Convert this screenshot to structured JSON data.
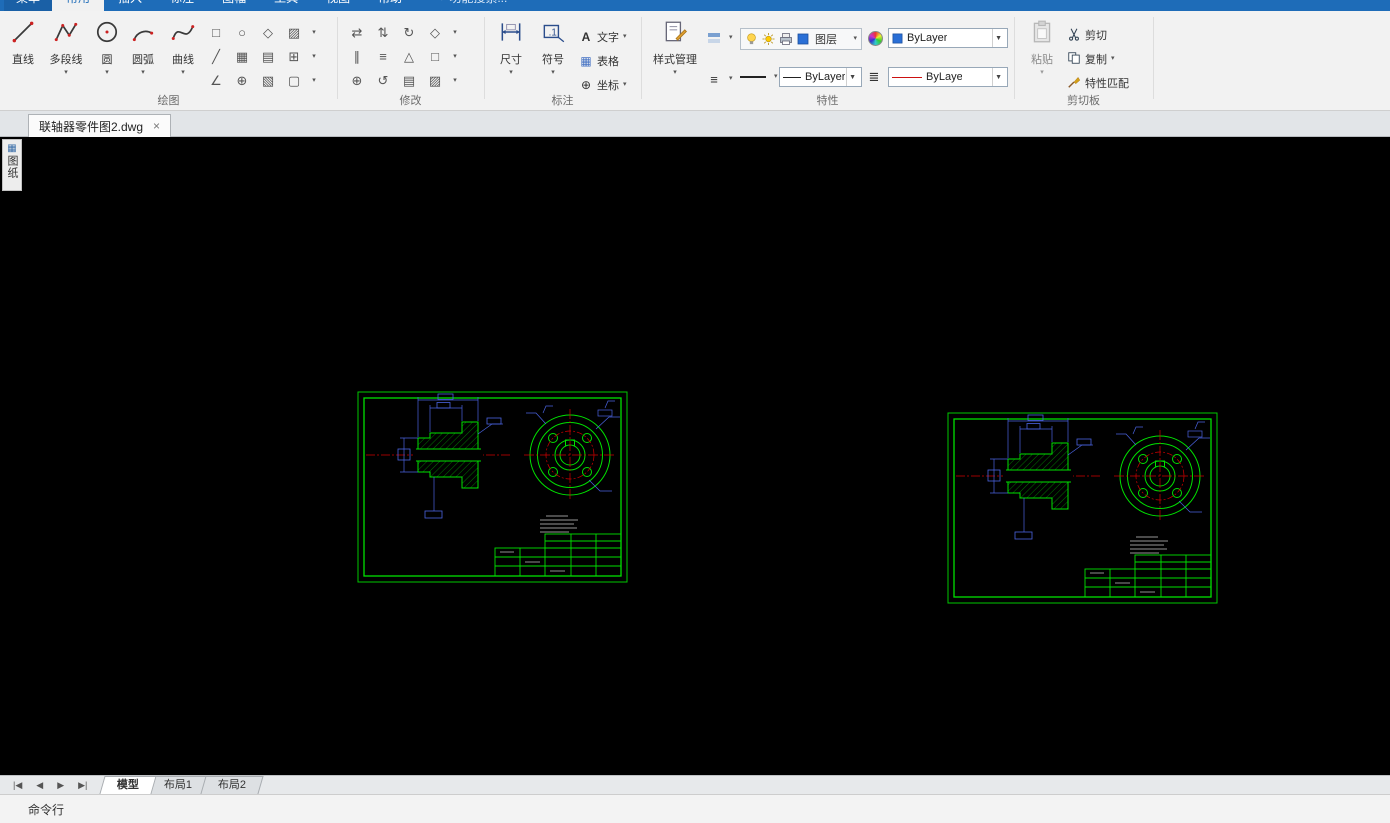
{
  "ui_icons": {
    "dropdown": "▾",
    "combo_arrow": "▼",
    "close": "×",
    "nav_first": "|◀",
    "nav_prev": "◀",
    "nav_next": "▶",
    "nav_last": "▶|",
    "lines_icon": "≡",
    "linetype_list_icon": "≣"
  },
  "menubar": {
    "menu_button": "菜单",
    "tabs": [
      {
        "label": "常用",
        "active": true
      },
      {
        "label": "插入",
        "active": false
      },
      {
        "label": "标注",
        "active": false
      },
      {
        "label": "图幅",
        "active": false
      },
      {
        "label": "工具",
        "active": false
      },
      {
        "label": "视图",
        "active": false
      },
      {
        "label": "帮助",
        "active": false
      }
    ],
    "search": {
      "icon": "✎",
      "placeholder": "功能搜索..."
    }
  },
  "ribbon": {
    "draw": {
      "label": "绘图",
      "big_buttons": [
        {
          "label": "直线"
        },
        {
          "label": "多段线"
        },
        {
          "label": "圆"
        },
        {
          "label": "圆弧"
        },
        {
          "label": "曲线"
        }
      ],
      "grid_icons": [
        "□",
        "○",
        "◇",
        "▨",
        "╱",
        "▦",
        "▤",
        "⊞",
        "∠",
        "⊕",
        "▧",
        "▢"
      ]
    },
    "modify": {
      "label": "修改",
      "grid_icons": [
        "⇄",
        "⇅",
        "↻",
        "◇",
        "∥",
        "≡",
        "△",
        "□",
        "⊕",
        "↺",
        "▤",
        "▨"
      ]
    },
    "annotate": {
      "label": "标注",
      "big_buttons": [
        {
          "label": "尺寸"
        },
        {
          "label": "符号"
        }
      ],
      "small_buttons": [
        {
          "label": "文字",
          "icon": "A"
        },
        {
          "label": "表格",
          "icon": "▦"
        },
        {
          "label": "坐标",
          "icon": "⊕"
        }
      ]
    },
    "properties": {
      "label": "特性",
      "style_button": {
        "label": "样式管理"
      },
      "layer_group_label": "图层",
      "layer_combo": "ByLayer",
      "lineweight_combo": "ByLayer",
      "linetype_combo": "ByLayer"
    },
    "clipboard": {
      "label": "剪切板",
      "paste": {
        "label": "粘贴"
      },
      "items": [
        {
          "label": "剪切"
        },
        {
          "label": "复制"
        },
        {
          "label": "特性匹配"
        }
      ]
    }
  },
  "document_tab": {
    "title": "联轴器零件图2.dwg"
  },
  "side_palette": {
    "icon": "▦",
    "label": "图纸"
  },
  "sheet_tabs": {
    "tabs": [
      {
        "label": "模型",
        "active": true
      },
      {
        "label": "布局1",
        "active": false
      },
      {
        "label": "布局2",
        "active": false
      }
    ]
  },
  "command_bar": {
    "label": "命令行"
  }
}
